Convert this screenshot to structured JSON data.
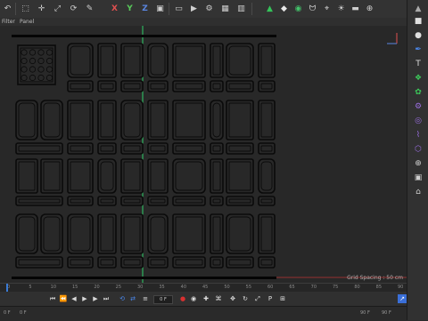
{
  "menu": {
    "items": [
      "Filter",
      "Panel"
    ]
  },
  "toolbar": {
    "axis_x": "X",
    "axis_y": "Y",
    "axis_z": "Z",
    "icons": [
      "undo-icon",
      "select-icon",
      "move-icon",
      "scale-icon",
      "rotate-icon",
      "axis-x",
      "axis-y",
      "axis-z",
      "coord-system-icon",
      "render-region-icon",
      "render-view-icon",
      "render-settings-icon",
      "cube-icon",
      "pen-icon",
      "subdivision-icon",
      "cloner-icon",
      "bend-icon",
      "floor-icon",
      "camera-icon",
      "light-icon",
      "snap-icon"
    ]
  },
  "viewport": {
    "grid_spacing": "Grid Spacing : 50 cm",
    "accent_green": "#2fd16a",
    "panel_stroke": "#0a0a0a"
  },
  "timeline": {
    "ticks": [
      "0",
      "5",
      "10",
      "15",
      "20",
      "25",
      "30",
      "35",
      "40",
      "45",
      "50",
      "55",
      "60",
      "65",
      "70",
      "75",
      "80",
      "85",
      "90"
    ],
    "current_frame": "0 F",
    "start_frame": "0 F",
    "end_frame": "90 F",
    "min_frame": "0 F",
    "max_frame": "90 F",
    "playhead_color": "#3a7bd5"
  },
  "palette": {
    "icons": [
      "scroll-up-icon",
      "cube-icon",
      "sphere-icon",
      "pen-icon",
      "text-icon",
      "subdivide-icon",
      "cloner-icon",
      "effector-icon",
      "deformer-icon",
      "spline-icon",
      "tag-icon",
      "camera-icon",
      "light-icon",
      "scene-icon"
    ]
  }
}
